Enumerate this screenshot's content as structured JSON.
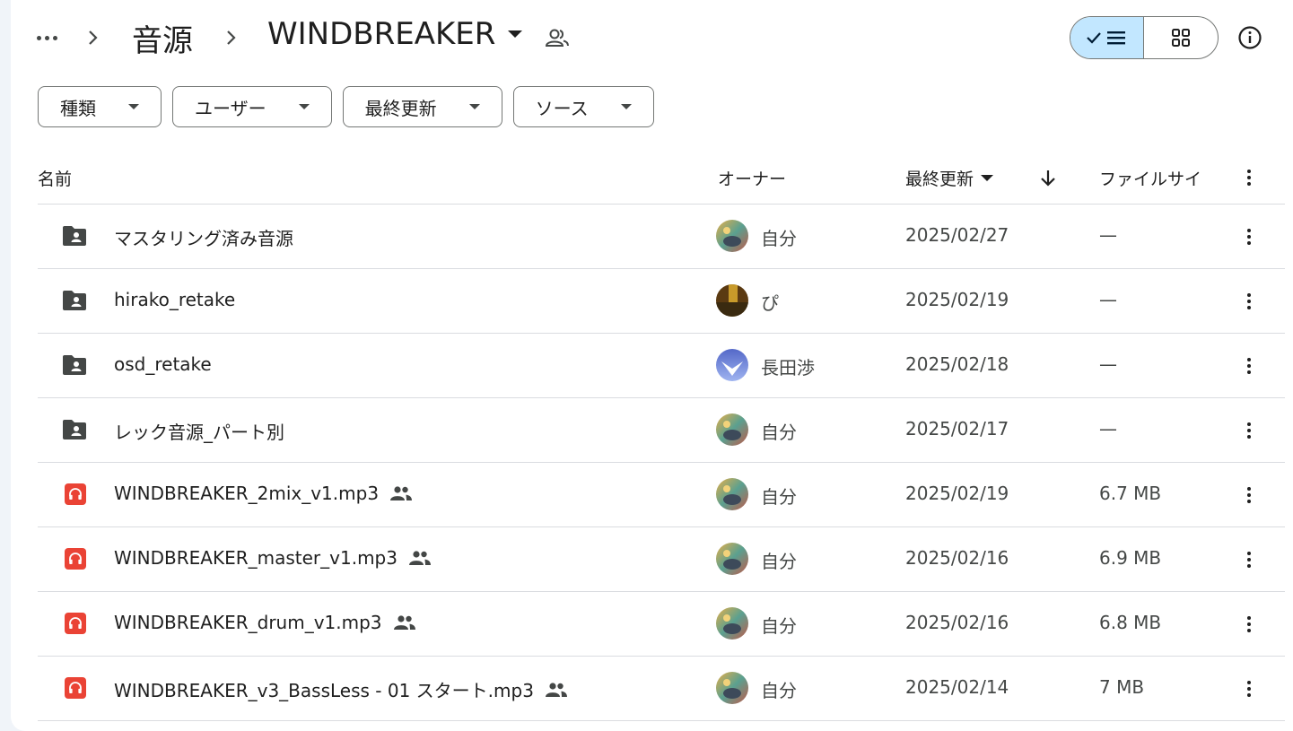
{
  "breadcrumb": {
    "parent": "音源",
    "current": "WINDBREAKER"
  },
  "filters": [
    {
      "label": "種類"
    },
    {
      "label": "ユーザー"
    },
    {
      "label": "最終更新"
    },
    {
      "label": "ソース"
    }
  ],
  "columns": {
    "name": "名前",
    "owner": "オーナー",
    "modified": "最終更新",
    "size": "ファイルサイ"
  },
  "files": [
    {
      "name": "マスタリング済み音源",
      "type": "folder",
      "owner": "自分",
      "modified": "2025/02/27",
      "size": "—",
      "shared": false
    },
    {
      "name": "hirako_retake",
      "type": "folder",
      "owner": "ぴ",
      "modified": "2025/02/19",
      "size": "—",
      "shared": false
    },
    {
      "name": "osd_retake",
      "type": "folder",
      "owner": "長田渉",
      "modified": "2025/02/18",
      "size": "—",
      "shared": false
    },
    {
      "name": "レック音源_パート別",
      "type": "folder",
      "owner": "自分",
      "modified": "2025/02/17",
      "size": "—",
      "shared": false
    },
    {
      "name": "WINDBREAKER_2mix_v1.mp3",
      "type": "audio",
      "owner": "自分",
      "modified": "2025/02/19",
      "size": "6.7 MB",
      "shared": true
    },
    {
      "name": "WINDBREAKER_master_v1.mp3",
      "type": "audio",
      "owner": "自分",
      "modified": "2025/02/16",
      "size": "6.9 MB",
      "shared": true
    },
    {
      "name": "WINDBREAKER_drum_v1.mp3",
      "type": "audio",
      "owner": "自分",
      "modified": "2025/02/16",
      "size": "6.8 MB",
      "shared": true
    },
    {
      "name": "WINDBREAKER_v3_BassLess - 01 スタート.mp3",
      "type": "audio",
      "owner": "自分",
      "modified": "2025/02/14",
      "size": "7 MB",
      "shared": true
    }
  ],
  "colors": {
    "accent": "#c2e7ff",
    "audio_icon": "#ea4335",
    "folder_icon": "#444746"
  }
}
